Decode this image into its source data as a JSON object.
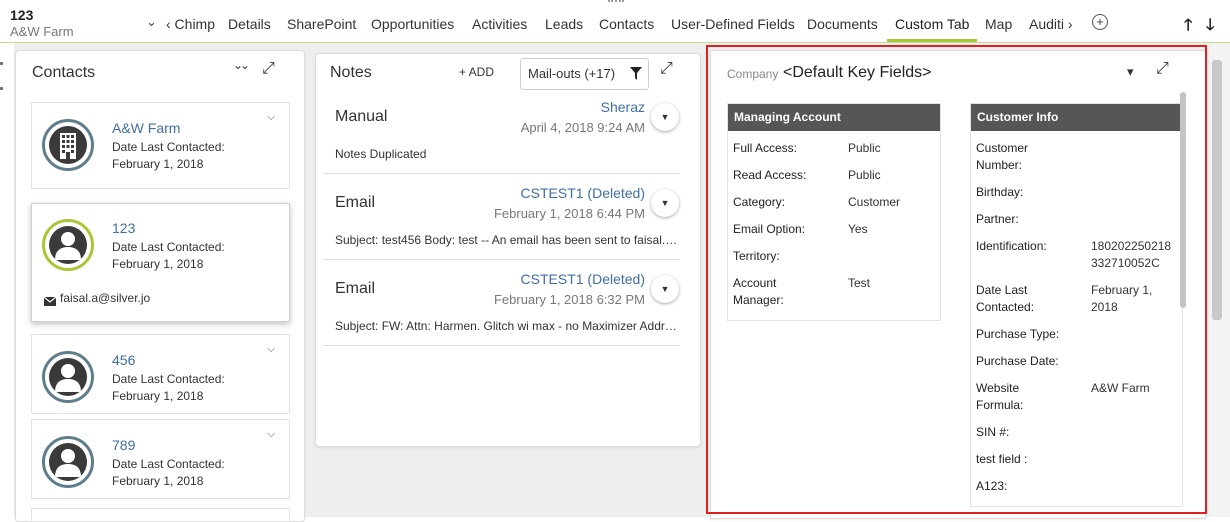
{
  "record": {
    "title": "123",
    "subtitle": "A&W Farm"
  },
  "tabs": {
    "overflow_chevron": "⌄",
    "items": [
      {
        "label": "‹ Chimp"
      },
      {
        "label": "Details"
      },
      {
        "label": "SharePoint"
      },
      {
        "label": "Opportunities"
      },
      {
        "label": "Activities"
      },
      {
        "label": "Leads"
      },
      {
        "label": "Contacts"
      },
      {
        "label": "User-Defined Fields"
      },
      {
        "label": "Documents"
      },
      {
        "label": "Custom Tab"
      },
      {
        "label": "Map"
      },
      {
        "label": "Auditi ›"
      }
    ],
    "active": "Custom Tab",
    "add_symbol": "+",
    "up_arrow": "🡑",
    "down_arrow": "🡓"
  },
  "colors": {
    "accent": "#a7c837",
    "link": "#3f6fa5",
    "highlight_border": "#e02020",
    "section_header": "#565656"
  },
  "contacts_panel": {
    "title": "Contacts",
    "collapse_icon": "⌄⌄",
    "expand_icon": "⤢",
    "cards": [
      {
        "name": "A&W Farm",
        "label": "Date Last Contacted:",
        "date": "February 1, 2018",
        "avatar": "building-icon"
      },
      {
        "name": "123",
        "label": "Date Last Contacted:",
        "date": "February 1, 2018",
        "avatar": "person-icon",
        "email": "faisal.a@silver.jo"
      },
      {
        "name": "456",
        "label": "Date Last Contacted:",
        "date": "February 1, 2018",
        "avatar": "person-icon"
      },
      {
        "name": "789",
        "label": "Date Last Contacted:",
        "date": "February 1, 2018",
        "avatar": "person-icon"
      }
    ]
  },
  "notes_panel": {
    "title": "Notes",
    "add_label": "+ ADD",
    "filter_value": "Mail-outs (+17)",
    "expand_icon": "⤢",
    "notes": [
      {
        "type": "Manual",
        "user": "Sheraz",
        "date": "April 4, 2018 9:24 AM",
        "body": "Notes Duplicated"
      },
      {
        "type": "Email",
        "user": "CSTEST1 (Deleted)",
        "date": "February 1, 2018 6:44 PM",
        "body": "Subject: test456 Body: test -- An email has been sent to faisal.a..."
      },
      {
        "type": "Email",
        "user": "CSTEST1 (Deleted)",
        "date": "February 1, 2018 6:32 PM",
        "body": "Subject: FW: Attn: Harmen. Glitch wi max - no Maximizer Addre..."
      }
    ]
  },
  "key_fields": {
    "company_label": "Company",
    "title": "<Default Key Fields>",
    "dropdown_icon": "▾",
    "expand_icon": "⤢",
    "managing_account": {
      "header": "Managing Account",
      "rows": [
        {
          "label": "Full Access:",
          "value": "Public"
        },
        {
          "label": "Read Access:",
          "value": "Public"
        },
        {
          "label": "Category:",
          "value": "Customer"
        },
        {
          "label": "Email Option:",
          "value": "Yes"
        },
        {
          "label": "Territory:",
          "value": ""
        },
        {
          "label": "Account",
          "label2": "Manager:",
          "value": "Test"
        }
      ]
    },
    "customer_info": {
      "header": "Customer Info",
      "rows": [
        {
          "label": "Customer",
          "label2": "Number:",
          "value": ""
        },
        {
          "label": "Birthday:",
          "value": ""
        },
        {
          "label": "Partner:",
          "value": ""
        },
        {
          "label": "Identification:",
          "value": "180202250218",
          "value2": "332710052C"
        },
        {
          "label": "Date Last",
          "label2": "Contacted:",
          "value": "February 1,",
          "value2": "2018"
        },
        {
          "label": "Purchase Type:",
          "value": ""
        },
        {
          "label": "Purchase Date:",
          "value": ""
        },
        {
          "label": "Website",
          "label2": "Formula:",
          "value": "A&W Farm"
        },
        {
          "label": "SIN #:",
          "value": ""
        },
        {
          "label": "test field :",
          "value": ""
        },
        {
          "label": "A123:",
          "value": ""
        }
      ]
    }
  }
}
